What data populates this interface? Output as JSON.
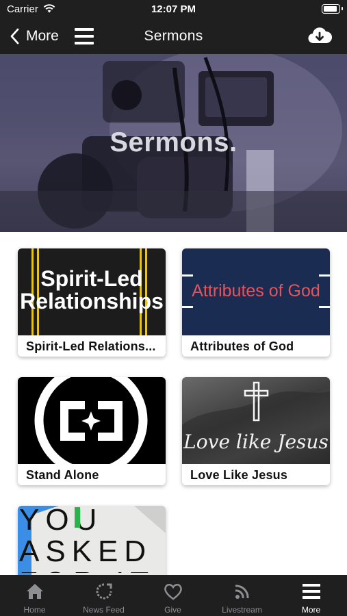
{
  "status_bar": {
    "carrier": "Carrier",
    "time": "12:07 PM"
  },
  "nav": {
    "back_label": "More",
    "title": "Sermons"
  },
  "hero": {
    "title": "Sermons."
  },
  "series": [
    {
      "title": "Spirit-Led Relations...",
      "art_text": "Spirit-Led Relationships"
    },
    {
      "title": "Attributes of God",
      "art_text": "Attributes of God"
    },
    {
      "title": "Stand Alone"
    },
    {
      "title": "Love Like Jesus",
      "art_text": "Love like Jesus"
    },
    {
      "art_text": "YOU ASKED FOR IT"
    }
  ],
  "tab_bar": {
    "items": [
      {
        "label": "Home",
        "icon": "home-icon"
      },
      {
        "label": "News Feed",
        "icon": "news-feed-icon"
      },
      {
        "label": "Give",
        "icon": "heart-icon"
      },
      {
        "label": "Livestream",
        "icon": "rss-icon"
      },
      {
        "label": "More",
        "icon": "hamburger-menu-icon"
      }
    ],
    "active": "More"
  },
  "colors": {
    "bar_background": "#1f1f1f",
    "tab_inactive": "#8e8e93",
    "tab_active": "#ffffff",
    "attributes_text": "#e0555f",
    "attributes_background": "#1b2c52",
    "spirit_lines": "#e5c228"
  }
}
